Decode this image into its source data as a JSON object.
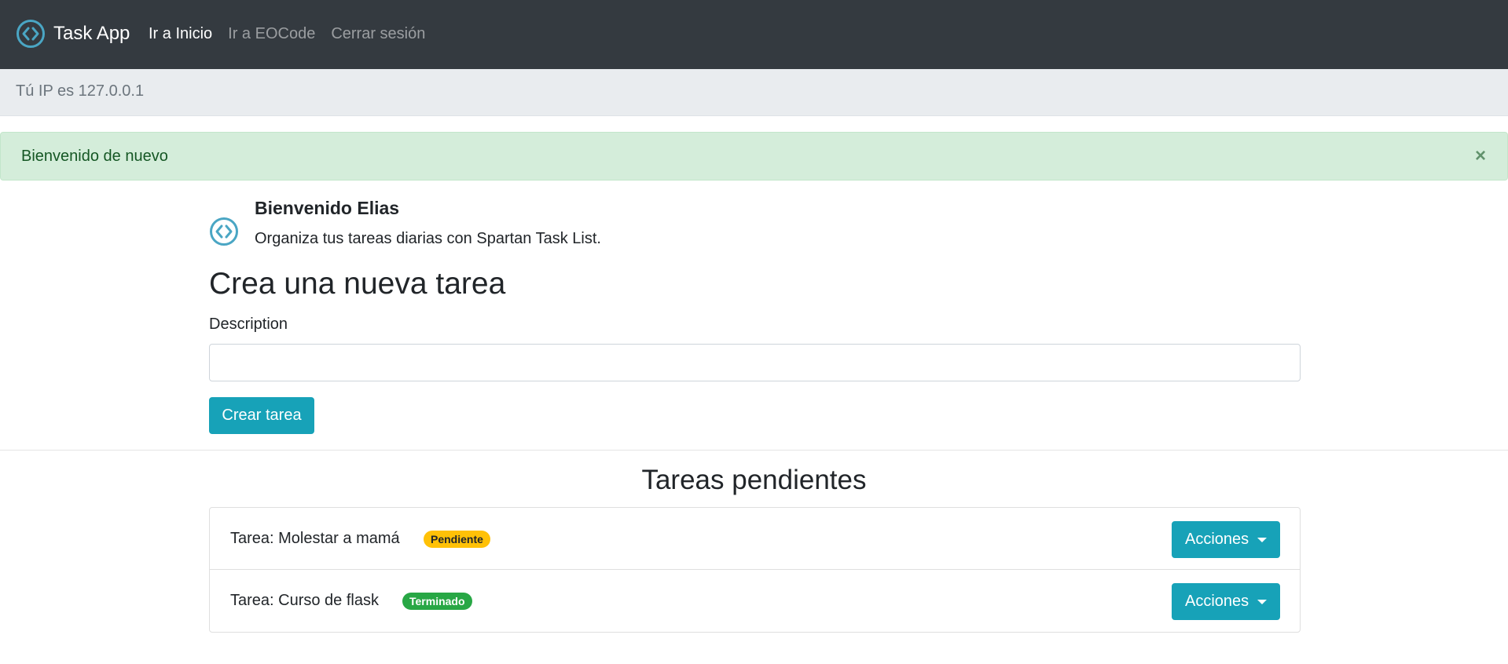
{
  "navbar": {
    "brand": "Task App",
    "logo_icon": "code-circle-icon",
    "links": [
      {
        "label": "Ir a Inicio",
        "active": true
      },
      {
        "label": "Ir a EOCode",
        "active": false
      },
      {
        "label": "Cerrar sesión",
        "active": false
      }
    ]
  },
  "ip_info": "Tú IP es 127.0.0.1",
  "alert": {
    "message": "Bienvenido de nuevo",
    "close": "×"
  },
  "welcome": {
    "title": "Bienvenido Elias",
    "subtitle": "Organiza tus tareas diarias con Spartan Task List."
  },
  "form": {
    "title": "Crea una nueva tarea",
    "label": "Description",
    "value": "",
    "button": "Crear tarea"
  },
  "tasks": {
    "title": "Tareas pendientes",
    "items": [
      {
        "text": "Tarea: Molestar a mamá",
        "status": "Pendiente",
        "action": "Acciones"
      },
      {
        "text": "Tarea: Curso de flask",
        "status": "Terminado",
        "action": "Acciones"
      }
    ]
  },
  "colors": {
    "navbar": "#343a40",
    "accent": "#17a2b8",
    "logo": "#4aa6c4",
    "success": "#28a745",
    "warning": "#ffc107",
    "alert_bg": "#d4edda"
  }
}
